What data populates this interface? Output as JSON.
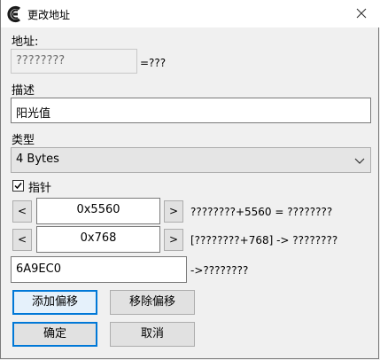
{
  "window": {
    "title": "更改地址"
  },
  "address": {
    "label": "地址:",
    "value": "????????",
    "result": "=???"
  },
  "description": {
    "label": "描述",
    "value": "阳光值"
  },
  "type": {
    "label": "类型",
    "selected": "4 Bytes"
  },
  "pointer": {
    "label": "指针",
    "checked": true
  },
  "offsets": [
    {
      "dec": "<",
      "value": "0x5560",
      "inc": ">",
      "expr": "????????+5560 = ????????"
    },
    {
      "dec": "<",
      "value": "0x768",
      "inc": ">",
      "expr": "[????????+768] -> ????????"
    }
  ],
  "base": {
    "value": "6A9EC0",
    "expr": "->????????"
  },
  "buttons": {
    "add_offset": "添加偏移",
    "remove_offset": "移除偏移",
    "ok": "确定",
    "cancel": "取消"
  },
  "icons": {
    "app": "cheat-engine-icon",
    "close": "close-icon",
    "dropdown": "chevron-down-icon",
    "check": "checkmark-icon"
  }
}
